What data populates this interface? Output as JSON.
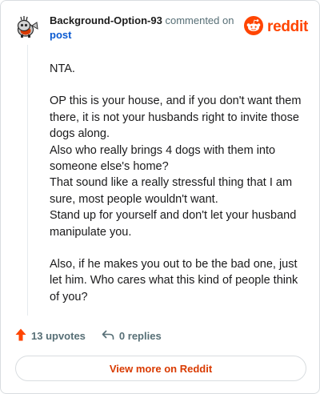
{
  "comment": {
    "username": "Background-Option-93",
    "commented_text": "commented on",
    "post_link": "post",
    "paragraphs": [
      "NTA.",
      "OP this is your house, and if you don't want them there, it is not your husbands right to invite those dogs along.\nAlso who really brings 4 dogs with them into someone else's home?\nThat sound like a really stressful thing that I am sure, most people wouldn't want.\nStand up for yourself and don't let your husband manipulate you.",
      "Also, if he makes you out to be the bad one, just let him. Who cares what this kind of people think of you?"
    ]
  },
  "brand": {
    "wordmark": "reddit",
    "color": "#ff4500"
  },
  "actions": {
    "upvotes_label": "13 upvotes",
    "replies_label": "0 replies"
  },
  "footer": {
    "view_more_label": "View more on Reddit"
  },
  "icons": [
    "user-avatar-icon",
    "reddit-logo-icon",
    "upvote-arrow-icon",
    "reply-arrow-icon"
  ]
}
